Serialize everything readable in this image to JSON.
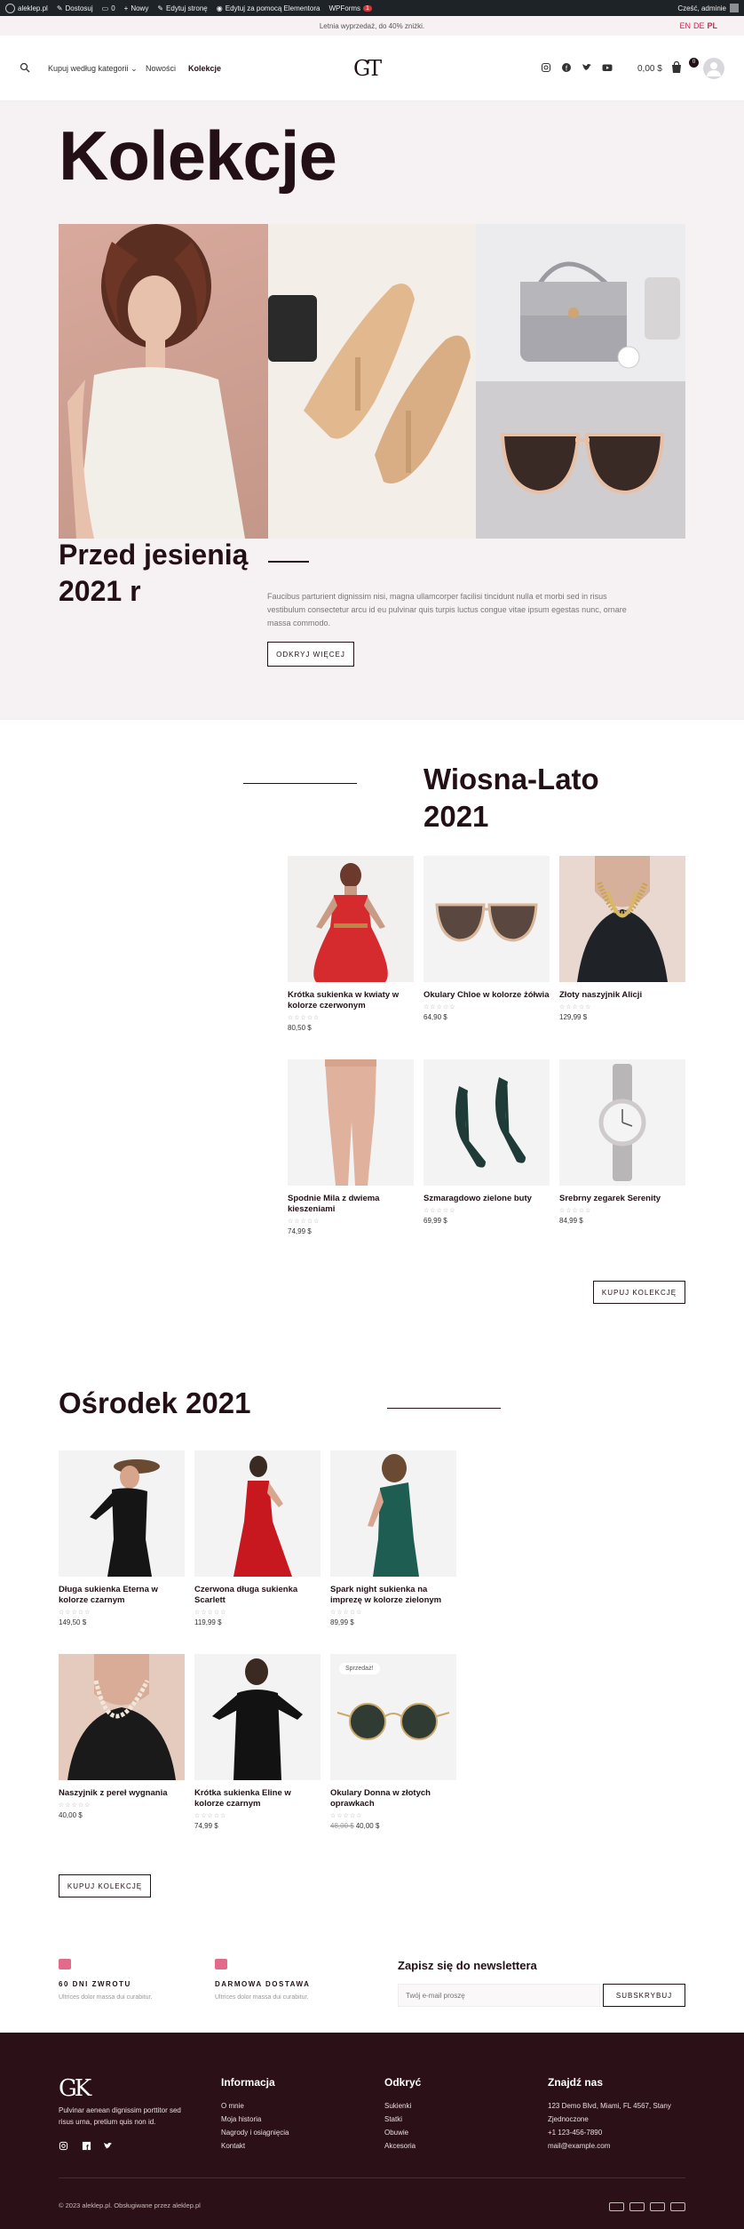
{
  "admin_bar": {
    "site": "aleklep.pl",
    "customize": "Dostosuj",
    "comments": "0",
    "new": "Nowy",
    "edit_page": "Edytuj stronę",
    "elementor": "Edytuj za pomocą Elementora",
    "wpforms": "WPForms",
    "wpforms_count": "1",
    "greeting": "Cześć, adminie"
  },
  "promo": {
    "text": "Letnia wyprzedaż, do 40% zniżki.",
    "lang_en": "EN",
    "lang_de": "DE",
    "lang_pl": "PL"
  },
  "header": {
    "nav": [
      "Kupuj według kategorii",
      "Nowości",
      "Kolekcje"
    ],
    "logo": "GT",
    "cart_total": "0,00 $",
    "cart_count": "0"
  },
  "hero": {
    "title": "Kolekcje",
    "subtitle": "Przed jesienią 2021 r",
    "text": "Faucibus parturient dignissim nisi, magna ullamcorper facilisi tincidunt nulla et morbi sed in risus vestibulum consectetur arcu id eu pulvinar quis turpis luctus congue vitae ipsum egestas nunc, ornare massa commodo.",
    "button": "ODKRYJ WIĘCEJ"
  },
  "spring": {
    "title": "Wiosna-Lato 2021",
    "button": "KUPUJ KOLEKCJĘ",
    "products": [
      {
        "name": "Krótka sukienka w kwiaty w kolorze czerwonym",
        "price": "80,50 $"
      },
      {
        "name": "Okulary Chloe w kolorze żółwia",
        "price": "64,90 $"
      },
      {
        "name": "Złoty naszyjnik Alicji",
        "price": "129,99 $"
      },
      {
        "name": "Spodnie Mila z dwiema kieszeniami",
        "price": "74,99 $"
      },
      {
        "name": "Szmaragdowo zielone buty",
        "price": "69,99 $"
      },
      {
        "name": "Srebrny zegarek Serenity",
        "price": "84,99 $"
      }
    ]
  },
  "midseason": {
    "title": "Ośrodek 2021",
    "button": "KUPUJ KOLEKCJĘ",
    "products": [
      {
        "name": "Długa sukienka Eterna w kolorze czarnym",
        "price": "149,50 $"
      },
      {
        "name": "Czerwona długa sukienka Scarlett",
        "price": "119,99 $"
      },
      {
        "name": "Spark night sukienka na imprezę w kolorze zielonym",
        "price": "89,99 $"
      },
      {
        "name": "Naszyjnik z pereł wygnania",
        "price": "40,00 $"
      },
      {
        "name": "Krótka sukienka Eline w kolorze czarnym",
        "price": "74,99 $"
      },
      {
        "name": "Okulary Donna w złotych oprawkach",
        "old_price": "48,00 $",
        "price": "40,00 $",
        "sale": "Sprzedaż!"
      }
    ]
  },
  "stars": "☆☆☆☆☆",
  "features": [
    {
      "title": "60 DNI ZWROTU",
      "text": "Ultrices dolor massa dui curabitur."
    },
    {
      "title": "DARMOWA DOSTAWA",
      "text": "Ultrices dolor massa dui curabitur."
    }
  ],
  "newsletter": {
    "title": "Zapisz się do newslettera",
    "placeholder": "Twój e-mail proszę",
    "button": "SUBSKRYBUJ"
  },
  "footer": {
    "logo": "GK",
    "description": "Pulvinar aenean dignissim porttitor sed risus urna, pretium quis non id.",
    "columns": [
      {
        "title": "Informacja",
        "links": [
          "O mnie",
          "Moja historia",
          "Nagrody i osiągnięcia",
          "Kontakt"
        ]
      },
      {
        "title": "Odkryć",
        "links": [
          "Sukienki",
          "Statki",
          "Obuwie",
          "Akcesoria"
        ]
      },
      {
        "title": "Znajdź nas",
        "links": [
          "123 Demo Blvd, Miami, FL 4567, Stany Zjednoczone",
          "+1 123-456-7890",
          "mail@example.com"
        ]
      }
    ],
    "copyright": "© 2023 aleklep.pl. Obsługiwane przez aleklep.pl"
  },
  "colors": {
    "accent": "#231016",
    "footer_bg": "#2b1017",
    "hero_bg": "#f6f1f3",
    "lang_active": "#c4284f",
    "feature_icon": "#e36a8a"
  }
}
